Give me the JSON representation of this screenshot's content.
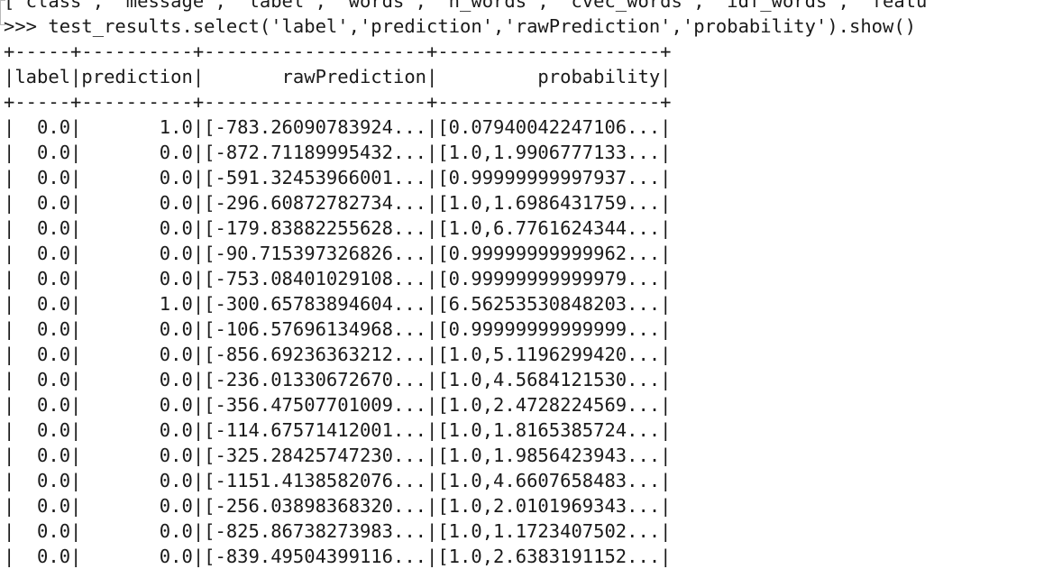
{
  "terminal": {
    "clipped_line": "[ class ,  message ,  label ,  words ,  n_words ,  cvec_words ,  idf_words ,  featu",
    "prompt": ">>> ",
    "command": "test_results.select('label','prediction','rawPrediction','probability').show()"
  },
  "table": {
    "border": "+-----+----------+--------------------+--------------------+",
    "columns": [
      "label",
      "prediction",
      "rawPrediction",
      "probability"
    ],
    "header_line": "|label|prediction|       rawPrediction|         probability|",
    "rows": [
      {
        "label": "0.0",
        "prediction": "1.0",
        "rawPrediction": "[-783.26090783924...",
        "probability": "[0.07940042247106..."
      },
      {
        "label": "0.0",
        "prediction": "0.0",
        "rawPrediction": "[-872.71189995432...",
        "probability": "[1.0,1.9906777133..."
      },
      {
        "label": "0.0",
        "prediction": "0.0",
        "rawPrediction": "[-591.32453966001...",
        "probability": "[0.99999999997937..."
      },
      {
        "label": "0.0",
        "prediction": "0.0",
        "rawPrediction": "[-296.60872782734...",
        "probability": "[1.0,1.6986431759..."
      },
      {
        "label": "0.0",
        "prediction": "0.0",
        "rawPrediction": "[-179.83882255628...",
        "probability": "[1.0,6.7761624344..."
      },
      {
        "label": "0.0",
        "prediction": "0.0",
        "rawPrediction": "[-90.715397326826...",
        "probability": "[0.99999999999962..."
      },
      {
        "label": "0.0",
        "prediction": "0.0",
        "rawPrediction": "[-753.08401029108...",
        "probability": "[0.99999999999979..."
      },
      {
        "label": "0.0",
        "prediction": "1.0",
        "rawPrediction": "[-300.65783894604...",
        "probability": "[6.56253530848203..."
      },
      {
        "label": "0.0",
        "prediction": "0.0",
        "rawPrediction": "[-106.57696134968...",
        "probability": "[0.99999999999999..."
      },
      {
        "label": "0.0",
        "prediction": "0.0",
        "rawPrediction": "[-856.69236363212...",
        "probability": "[1.0,5.1196299420..."
      },
      {
        "label": "0.0",
        "prediction": "0.0",
        "rawPrediction": "[-236.01330672670...",
        "probability": "[1.0,4.5684121530..."
      },
      {
        "label": "0.0",
        "prediction": "0.0",
        "rawPrediction": "[-356.47507701009...",
        "probability": "[1.0,2.4728224569..."
      },
      {
        "label": "0.0",
        "prediction": "0.0",
        "rawPrediction": "[-114.67571412001...",
        "probability": "[1.0,1.8165385724..."
      },
      {
        "label": "0.0",
        "prediction": "0.0",
        "rawPrediction": "[-325.28425747230...",
        "probability": "[1.0,1.9856423943..."
      },
      {
        "label": "0.0",
        "prediction": "0.0",
        "rawPrediction": "[-1151.4138582076...",
        "probability": "[1.0,4.6607658483..."
      },
      {
        "label": "0.0",
        "prediction": "0.0",
        "rawPrediction": "[-256.03898368320...",
        "probability": "[1.0,2.0101969343..."
      },
      {
        "label": "0.0",
        "prediction": "0.0",
        "rawPrediction": "[-825.86738273983...",
        "probability": "[1.0,1.1723407502..."
      },
      {
        "label": "0.0",
        "prediction": "0.0",
        "rawPrediction": "[-839.49504399116...",
        "probability": "[1.0,2.6383191152..."
      }
    ]
  }
}
